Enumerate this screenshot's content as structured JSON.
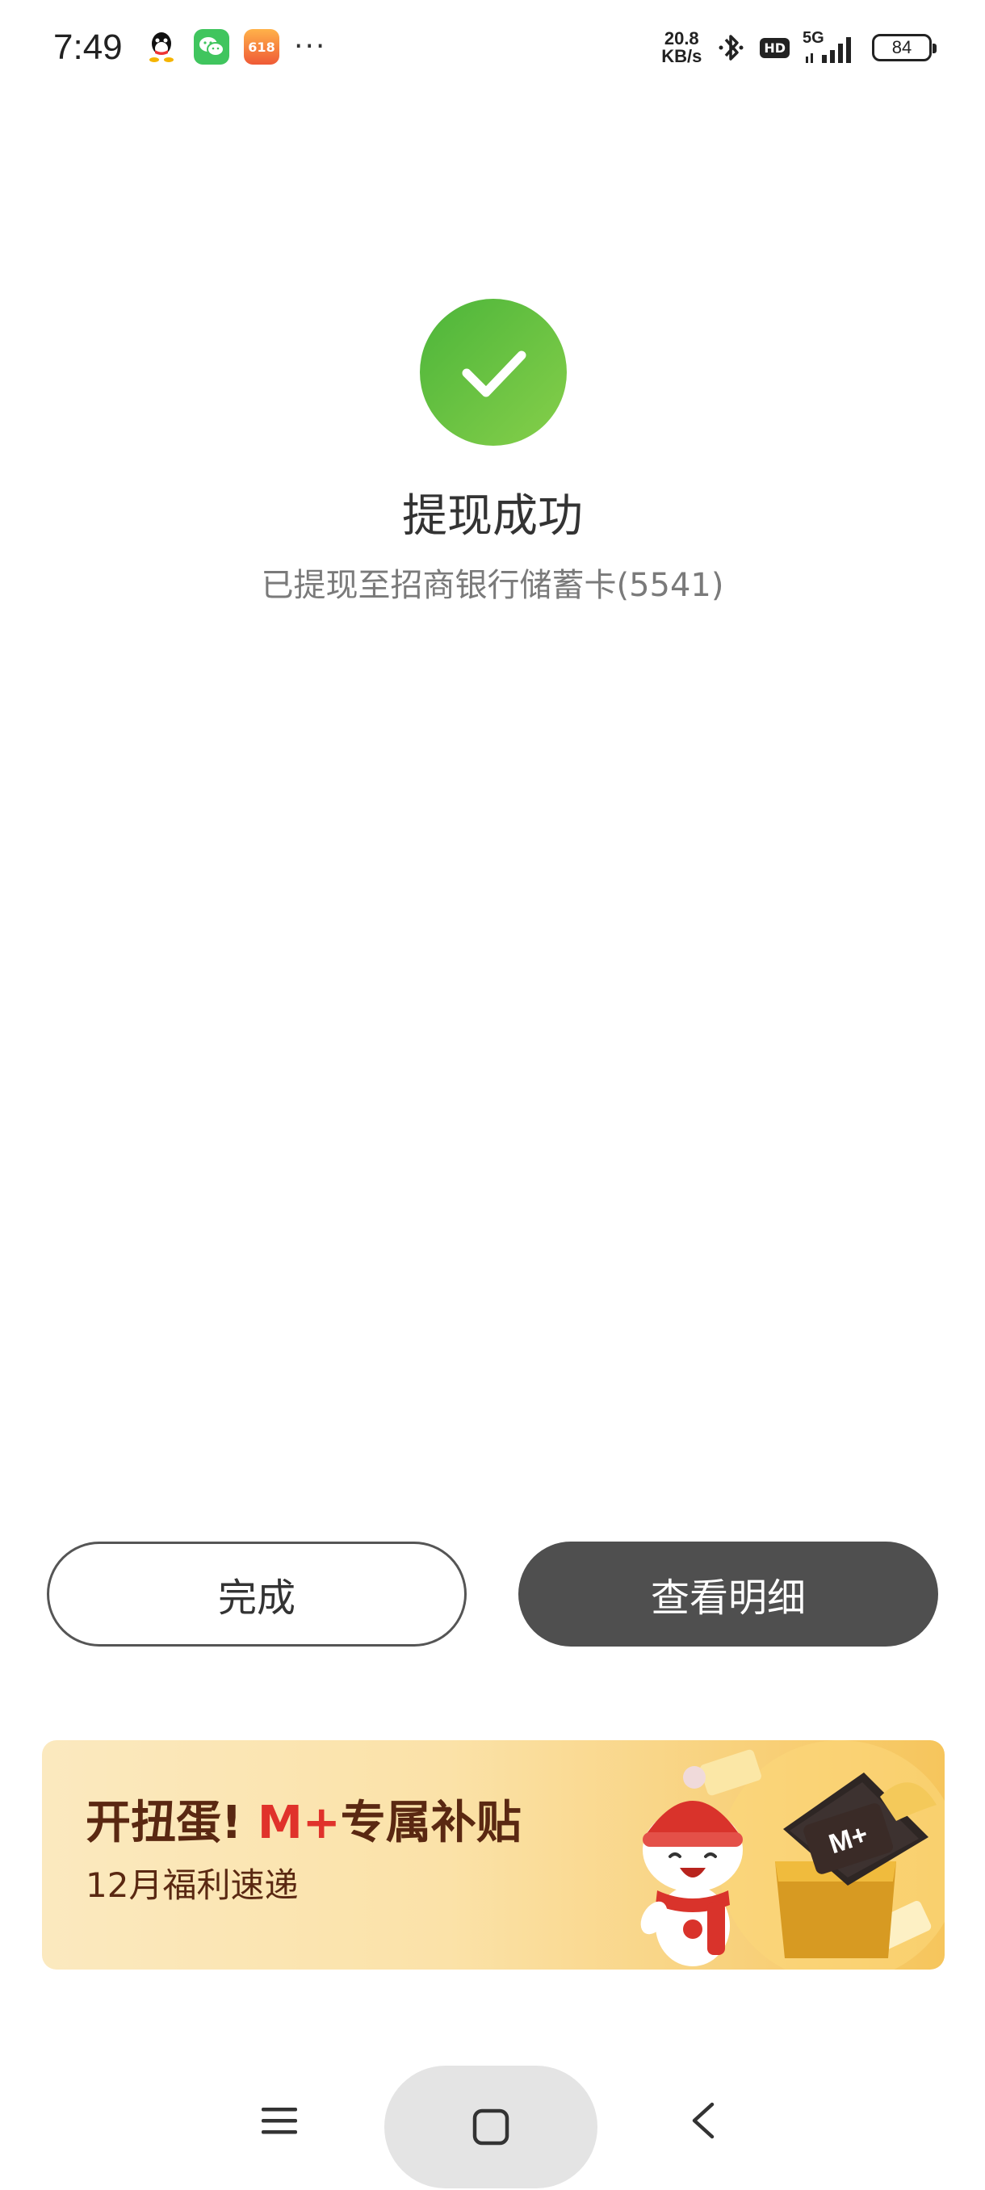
{
  "status_bar": {
    "time": "7:49",
    "net_speed_value": "20.8",
    "net_speed_unit": "KB/s",
    "hd_label": "HD",
    "network_label": "5G",
    "battery_level": "84",
    "more_label": "···",
    "icons": [
      "qq-icon",
      "wechat-icon",
      "app-618-icon",
      "bluetooth-icon",
      "signal-icon",
      "battery-icon"
    ]
  },
  "result": {
    "icon": "check-circle-icon",
    "title": "提现成功",
    "subtitle": "已提现至招商银行储蓄卡(5541)"
  },
  "actions": {
    "done_label": "完成",
    "detail_label": "查看明细"
  },
  "banner": {
    "title_prefix": "开扭蛋! ",
    "title_accent": "M+",
    "title_suffix": "专属补贴",
    "subtitle": "12月福利速递",
    "logo_label": "M+",
    "app618_label": "618"
  },
  "nav": {
    "icons": [
      "menu-icon",
      "home-icon",
      "back-icon"
    ]
  },
  "colors": {
    "success_green": "#4cb53a",
    "primary_button": "#4f4f4f",
    "banner_accent": "#e0322b",
    "banner_text": "#5a2812"
  }
}
